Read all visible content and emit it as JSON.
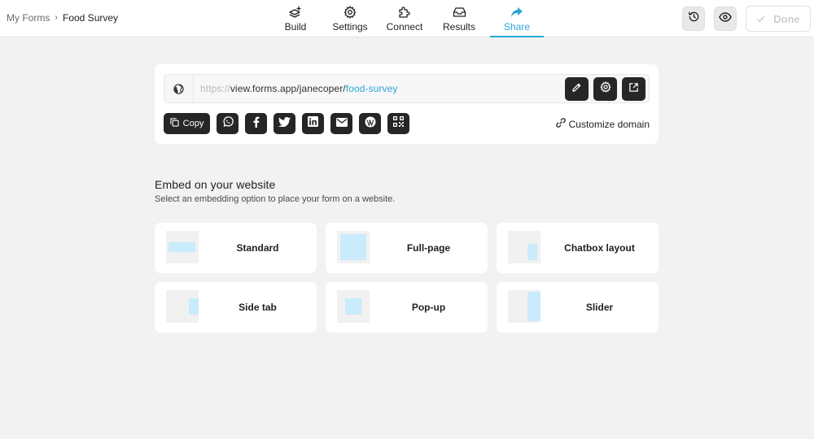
{
  "breadcrumb": {
    "parent": "My Forms",
    "separator": "›",
    "current": "Food Survey"
  },
  "tabs": [
    {
      "label": "Build",
      "icon": "layers-plus-icon",
      "active": false
    },
    {
      "label": "Settings",
      "icon": "gear-icon",
      "active": false
    },
    {
      "label": "Connect",
      "icon": "puzzle-icon",
      "active": false
    },
    {
      "label": "Results",
      "icon": "inbox-icon",
      "active": false
    },
    {
      "label": "Share",
      "icon": "share-arrow-icon",
      "active": true
    }
  ],
  "header_actions": {
    "history_icon": "history-icon",
    "preview_icon": "eye-icon",
    "done_label": "Done"
  },
  "share": {
    "url_protocol": "https://",
    "url_domain": "view.forms.app/janecoper/",
    "url_slug": "food-survey",
    "copy_label": "Copy",
    "social": [
      "whatsapp-icon",
      "facebook-icon",
      "twitter-icon",
      "linkedin-icon",
      "email-icon",
      "wordpress-icon",
      "qr-code-icon"
    ],
    "customize_domain_label": "Customize domain"
  },
  "embed": {
    "title": "Embed on your website",
    "subtitle": "Select an embedding option to place your form on a website.",
    "options": [
      {
        "label": "Standard"
      },
      {
        "label": "Full-page"
      },
      {
        "label": "Chatbox layout"
      },
      {
        "label": "Side tab"
      },
      {
        "label": "Pop-up"
      },
      {
        "label": "Slider"
      }
    ]
  },
  "colors": {
    "accent": "#2aa7d6",
    "dark_button": "#262626",
    "thumb_fill": "#c9ebfb",
    "background": "#f2f2f2"
  }
}
